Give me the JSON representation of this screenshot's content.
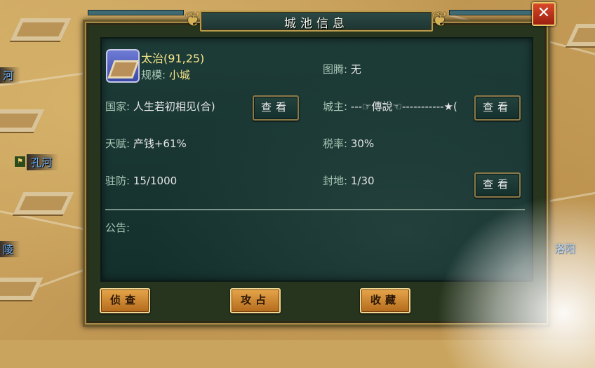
{
  "map": {
    "labels": [
      "河",
      "孔河",
      "陵",
      "洛阳"
    ]
  },
  "dialog": {
    "title": "城池信息",
    "close_glyph": "✕",
    "city": {
      "name_coords": "太治(91,25)",
      "scale_label": "规模:",
      "scale_value": "小城",
      "nation_label": "国家:",
      "nation_value": "人生若初相见(合)",
      "talent_label": "天赋:",
      "talent_value": "产钱+61%",
      "garrison_label": "驻防:",
      "garrison_value": "15/1000",
      "totem_label": "图腾:",
      "totem_value": "无",
      "lord_label": "城主:",
      "lord_value": "---☞傳說☜-----------★(",
      "tax_label": "税率:",
      "tax_value": "30%",
      "fief_label": "封地:",
      "fief_value": "1/30",
      "notice_label": "公告:"
    },
    "buttons": {
      "view_nation": "查看",
      "view_lord": "查看",
      "view_fief": "查看",
      "scout": "侦查",
      "attack": "攻占",
      "favorite": "收藏"
    }
  }
}
